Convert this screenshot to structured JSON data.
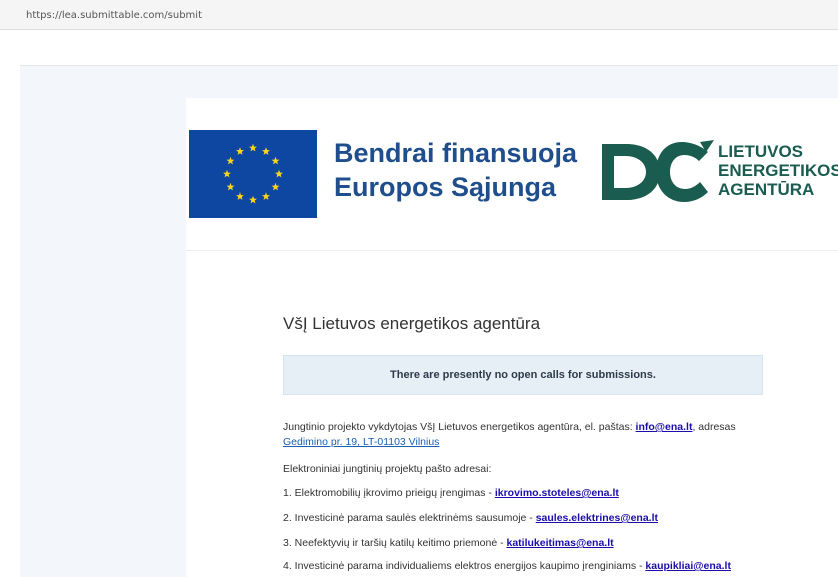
{
  "browser": {
    "url": "https://lea.submittable.com/submit"
  },
  "banner": {
    "cofund_line1": "Bendrai finansuoja",
    "cofund_line2": "Europos Sąjunga",
    "lea_line1": "LIETUVOS",
    "lea_line2": "ENERGETIKOS",
    "lea_line3": "AGENTŪRA"
  },
  "main": {
    "org_title": "VšĮ Lietuvos energetikos agentūra",
    "notice": "There are presently no open calls for submissions.",
    "intro_prefix": "Jungtinio projekto vykdytojas VšĮ Lietuvos energetikos agentūra, el. paštas: ",
    "intro_email": "info@ena.lt",
    "intro_mid": ", adresas",
    "intro_address": "Gedimino pr. 19, LT-01103 Vilnius",
    "emails_heading": "Elektroniniai jungtinių projektų pašto adresai:",
    "items": [
      {
        "text": "1. Elektromobilių įkrovimo prieigų įrengimas - ",
        "email": "ikrovimo.stoteles@ena.lt"
      },
      {
        "text": "2. Investicinė parama saulės elektrinėms sausumoje - ",
        "email": "saules.elektrines@ena.lt"
      },
      {
        "text": "3. Neefektyvių ir taršių katilų keitimo priemonė - ",
        "email": "katilukeitimas@ena.lt"
      },
      {
        "text": "4. Investicinė parama individualiems elektros energijos kaupimo įrenginiams - ",
        "email": "kaupikliai@ena.lt"
      }
    ]
  },
  "colors": {
    "eu_blue": "#0e47a1",
    "eu_star": "#ffd617",
    "cofund_text": "#1f4e8c",
    "lea_green": "#1a5c50",
    "notice_bg": "#e6eff6",
    "page_bg": "#f3f7fc"
  },
  "icons": {
    "eu_flag": "eu-flag",
    "lea_logo": "lea-logo"
  }
}
